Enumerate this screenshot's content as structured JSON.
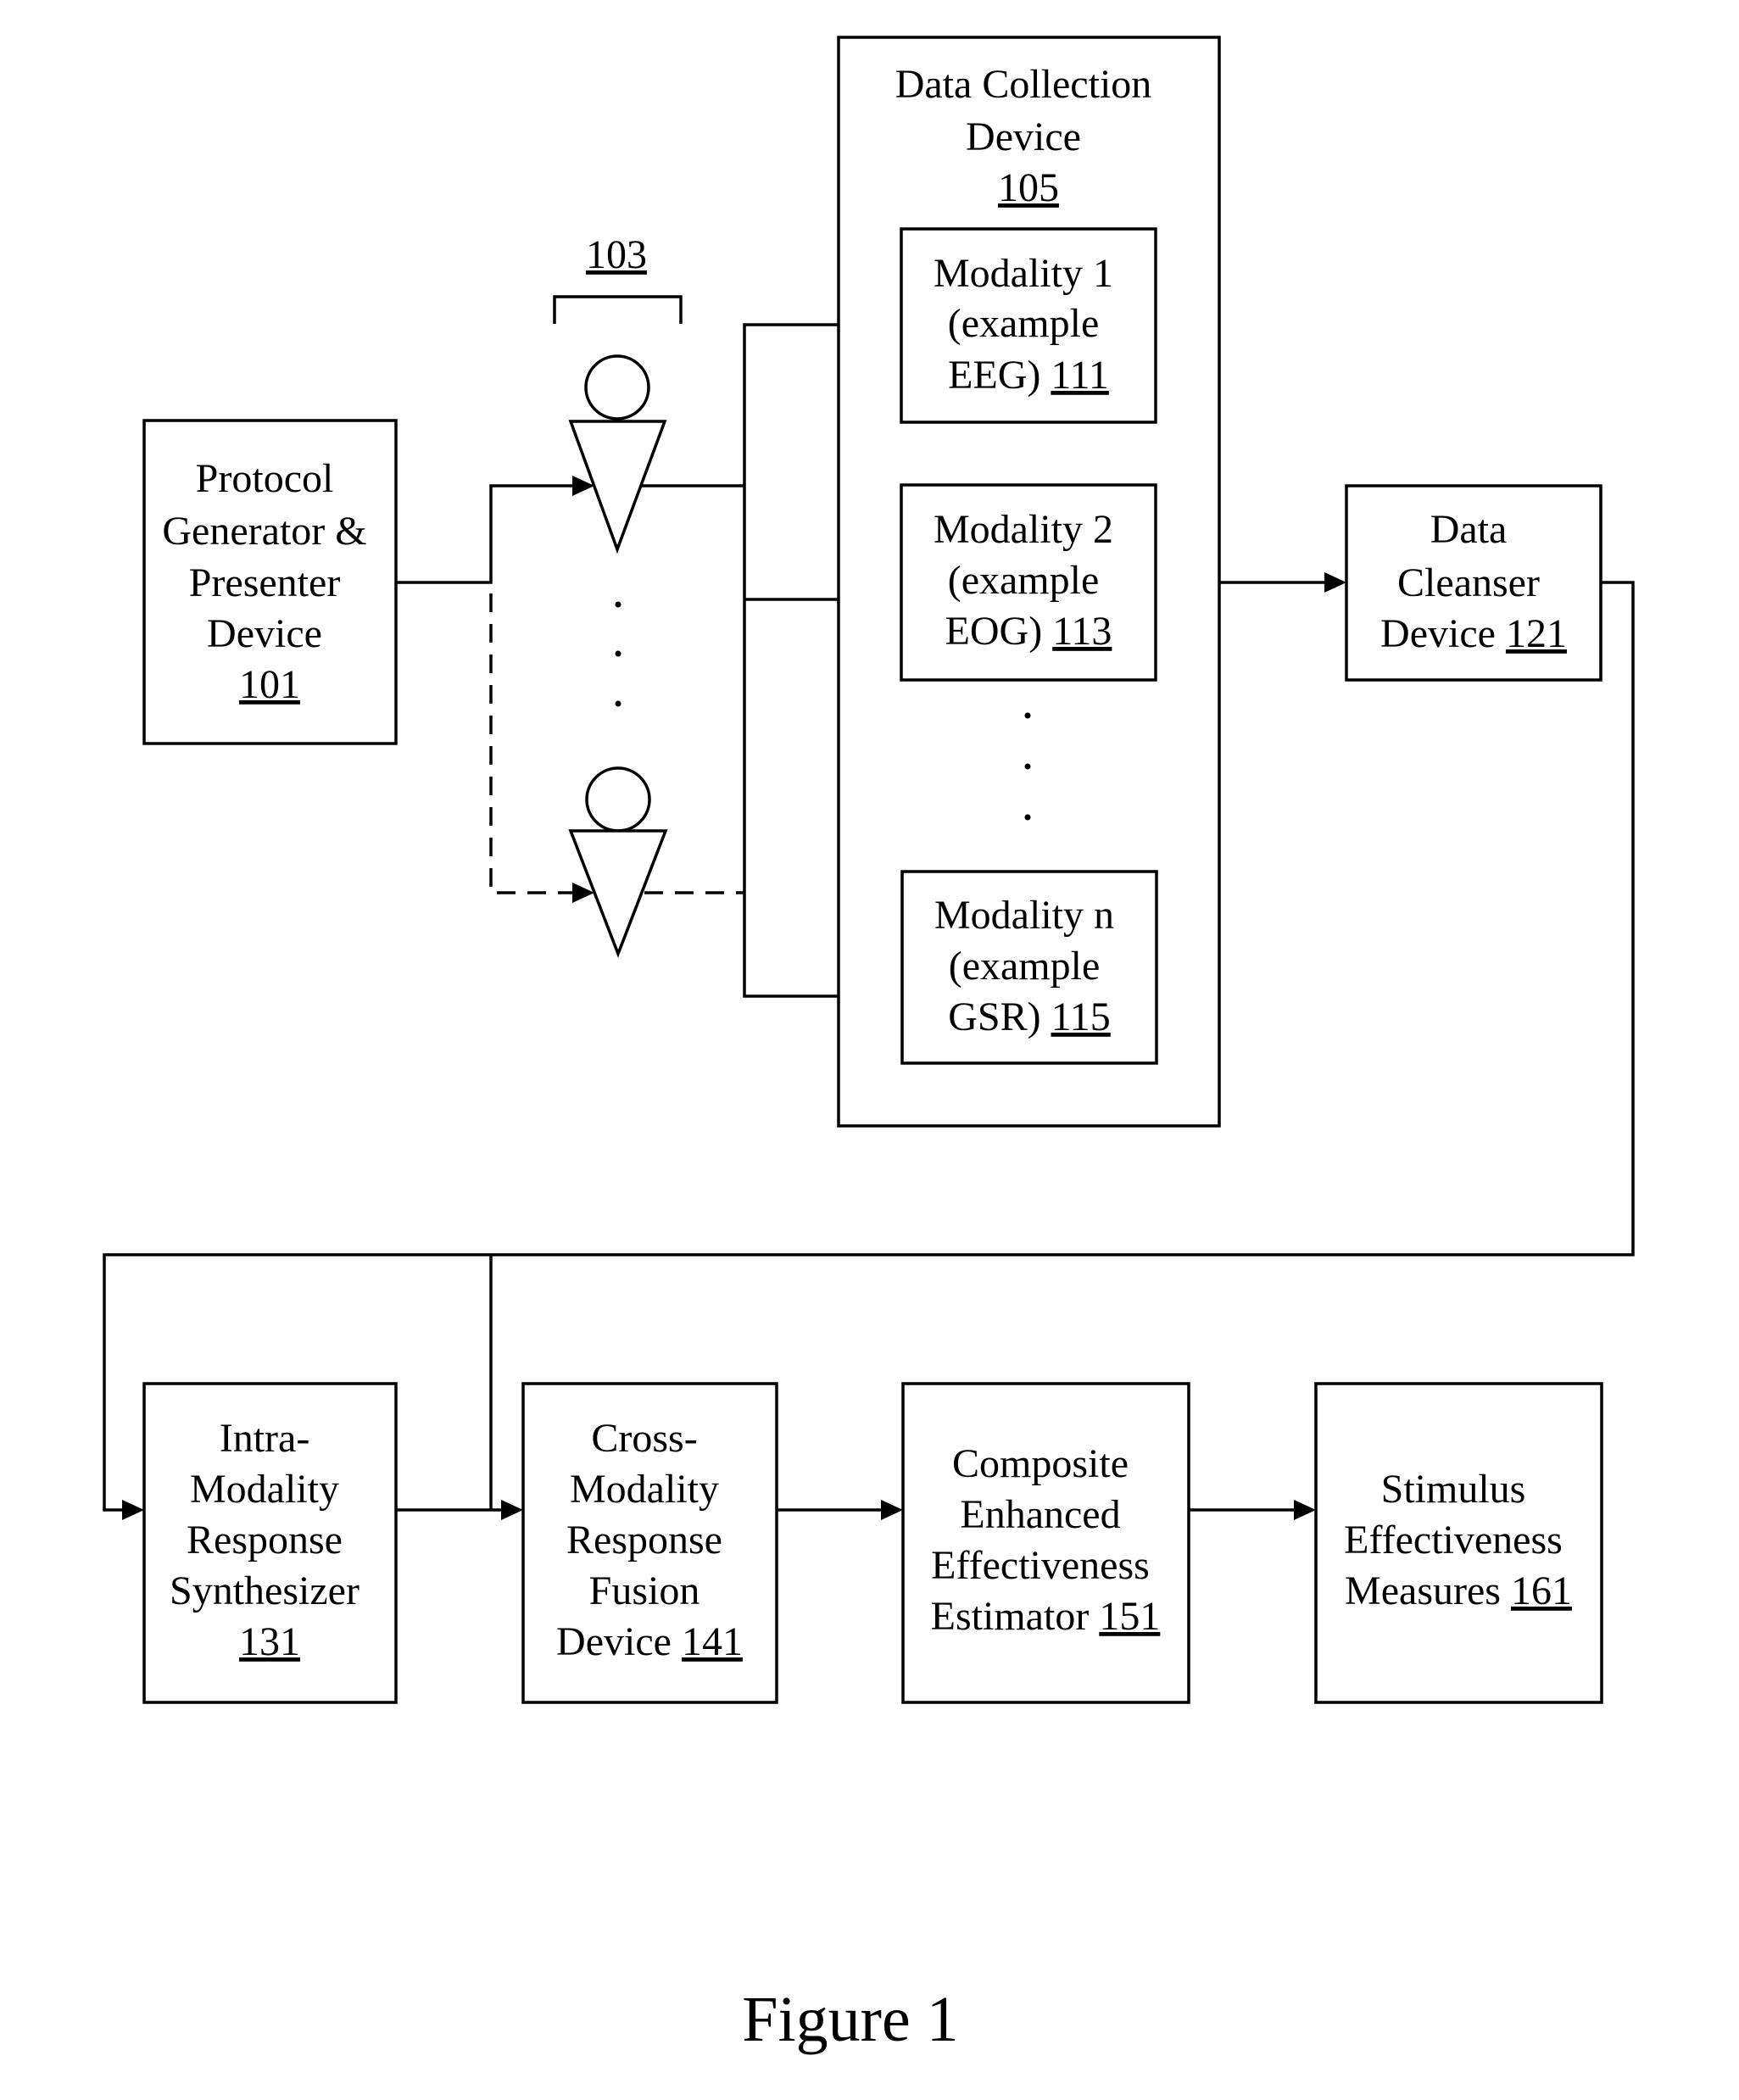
{
  "figure_caption": "Figure 1",
  "subjects": {
    "ref": "103",
    "count_shown": 2,
    "ellipsis": "..."
  },
  "blocks": {
    "protocol_generator": {
      "lines": [
        "Protocol",
        "Generator &",
        "Presenter",
        "Device"
      ],
      "ref": "101"
    },
    "data_collection": {
      "lines": [
        "Data Collection",
        "Device"
      ],
      "ref": "105"
    },
    "modality_1": {
      "lines": [
        "Modality 1",
        "(example",
        "EEG)"
      ],
      "ref": "111"
    },
    "modality_2": {
      "lines": [
        "Modality 2",
        "(example",
        "EOG)"
      ],
      "ref": "113"
    },
    "modality_n": {
      "lines": [
        "Modality n",
        "(example",
        "GSR)"
      ],
      "ref": "115"
    },
    "data_cleanser": {
      "lines": [
        "Data",
        "Cleanser",
        "Device"
      ],
      "ref": "121"
    },
    "intra_modality": {
      "lines": [
        "Intra-",
        "Modality",
        "Response",
        "Synthesizer"
      ],
      "ref": "131"
    },
    "cross_modality": {
      "lines": [
        "Cross-",
        "Modality",
        "Response",
        "Fusion",
        "Device"
      ],
      "ref": "141"
    },
    "composite_estimator": {
      "lines": [
        "Composite",
        "Enhanced",
        "Effectiveness",
        "Estimator"
      ],
      "ref": "151"
    },
    "stimulus_measures": {
      "lines": [
        "Stimulus",
        "Effectiveness",
        "Measures"
      ],
      "ref": "161"
    }
  },
  "colors": {
    "stroke": "#000000",
    "background": "#ffffff"
  }
}
